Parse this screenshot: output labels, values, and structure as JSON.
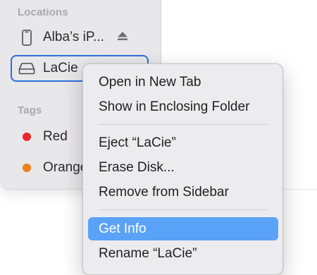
{
  "sidebar": {
    "locations_header": "Locations",
    "tags_header": "Tags",
    "locations": [
      {
        "label": "Alba’s iP...",
        "icon": "iphone-icon"
      },
      {
        "label": "LaCie",
        "icon": "external-disk-icon"
      }
    ],
    "tags": [
      {
        "label": "Red",
        "color": "#e8262b"
      },
      {
        "label": "Orange",
        "color": "#f07f1b"
      }
    ]
  },
  "context_menu": {
    "items": [
      "Open in New Tab",
      "Show in Enclosing Folder",
      "Eject “LaCie”",
      "Erase Disk...",
      "Remove from Sidebar",
      "Get Info",
      "Rename “LaCie”"
    ],
    "highlighted": "Get Info",
    "highlight_color": "#5aa2f7"
  },
  "colors": {
    "selection_border": "#2e6fd8",
    "sidebar_bg": "#e8e7ea",
    "menu_bg": "#ececee"
  }
}
